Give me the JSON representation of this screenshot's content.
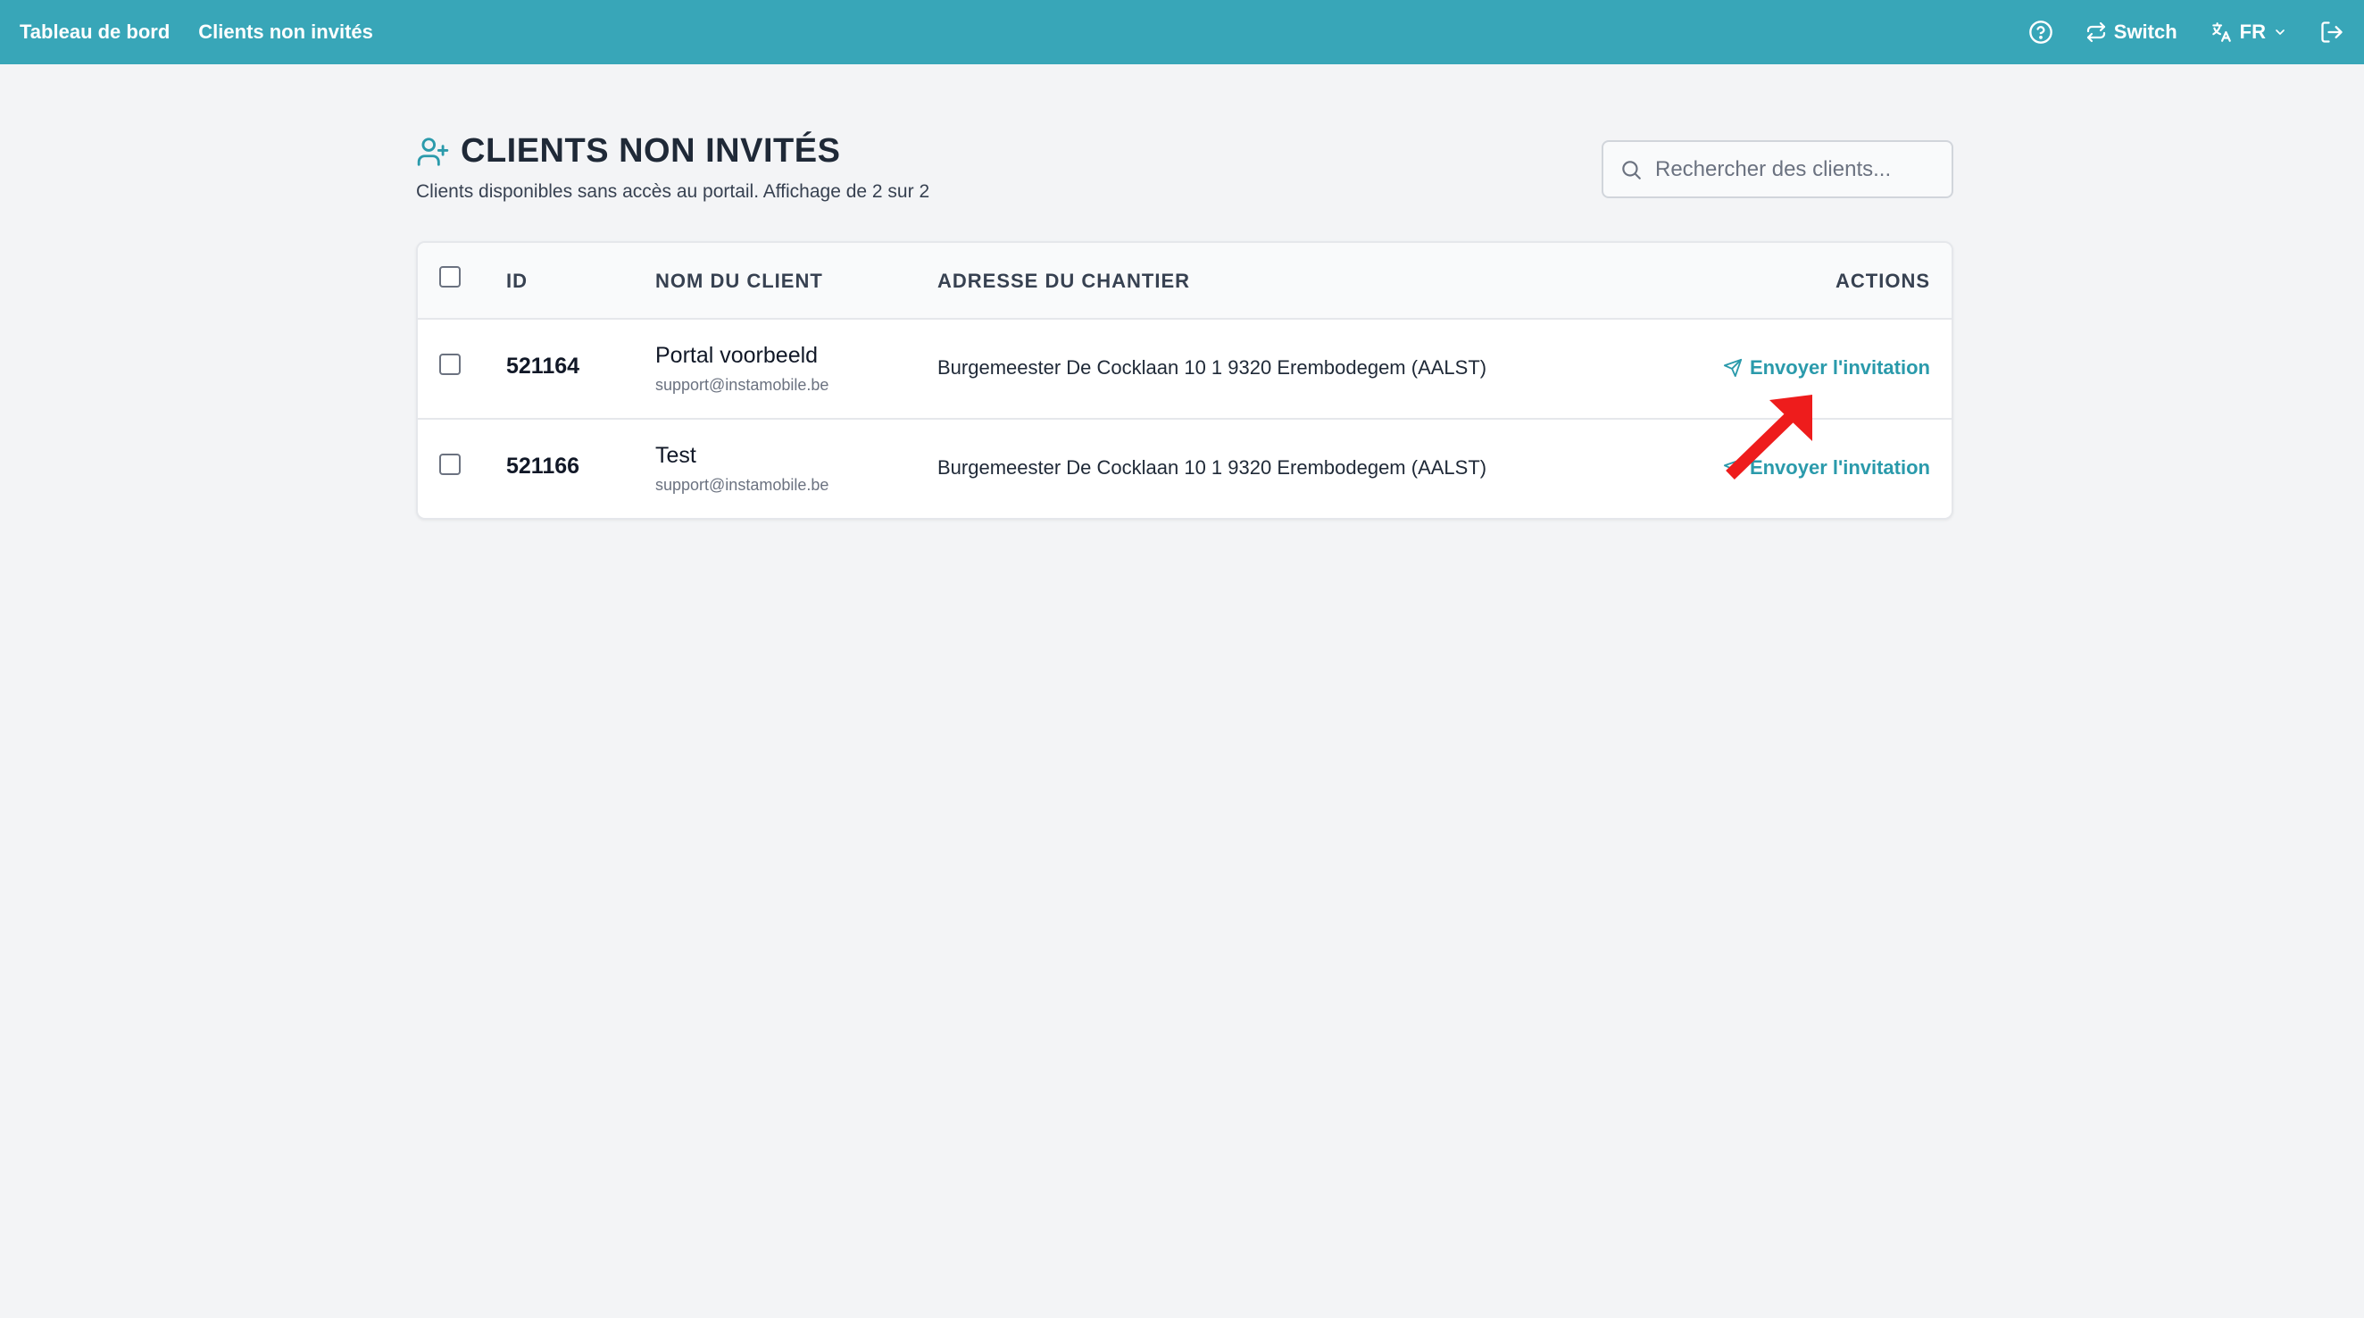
{
  "topbar": {
    "nav": [
      "Tableau de bord",
      "Clients non invités"
    ],
    "switch_label": "Switch",
    "lang_label": "FR"
  },
  "page": {
    "title": "CLIENTS NON INVITÉS",
    "subtitle": "Clients disponibles sans accès au portail. Affichage de 2 sur 2"
  },
  "search": {
    "placeholder": "Rechercher des clients..."
  },
  "table": {
    "headers": {
      "id": "ID",
      "name": "NOM DU CLIENT",
      "address": "ADRESSE DU CHANTIER",
      "actions": "ACTIONS"
    },
    "rows": [
      {
        "id": "521164",
        "name": "Portal voorbeeld",
        "email": "support@instamobile.be",
        "address": "Burgemeester De Cocklaan 10 1 9320 Erembodegem (AALST)",
        "action": "Envoyer l'invitation"
      },
      {
        "id": "521166",
        "name": "Test",
        "email": "support@instamobile.be",
        "address": "Burgemeester De Cocklaan 10 1 9320 Erembodegem (AALST)",
        "action": "Envoyer l'invitation"
      }
    ]
  },
  "colors": {
    "header_bg": "#38a6b8",
    "accent": "#2a9aab",
    "annotation": "#ee1c1c"
  },
  "icons": [
    "help-icon",
    "switch-icon",
    "translate-icon",
    "chevron-down-icon",
    "logout-icon",
    "user-plus-icon",
    "search-icon",
    "send-icon"
  ]
}
